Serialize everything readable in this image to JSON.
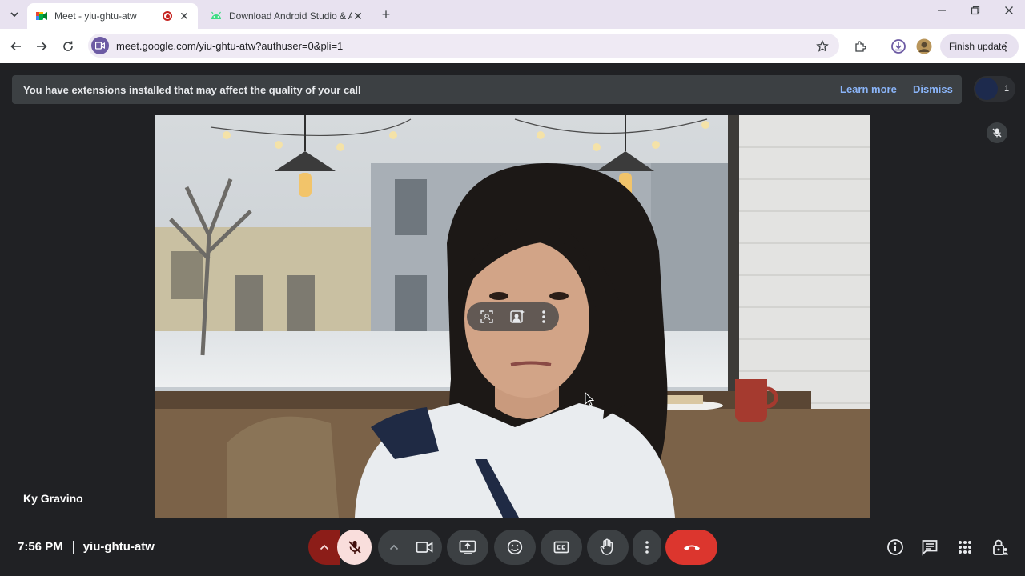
{
  "browser": {
    "tabs": [
      {
        "title": "Meet - yiu-ghtu-atw",
        "favicon": "google-meet-icon",
        "recording": true,
        "active": true
      },
      {
        "title": "Download Android Studio & App",
        "favicon": "android-icon",
        "active": false
      }
    ],
    "url": "meet.google.com/yiu-ghtu-atw?authuser=0&pli=1",
    "finish_update_label": "Finish update"
  },
  "meet": {
    "banner": {
      "message": "You have extensions installed that may affect the quality of your call",
      "learn_more": "Learn more",
      "dismiss": "Dismiss"
    },
    "participant_count": "1",
    "self_name": "Ky Gravino",
    "time": "7:56 PM",
    "meeting_code": "yiu-ghtu-atw",
    "mic_muted": true,
    "controls": [
      "mic-options",
      "microphone",
      "camera-options",
      "camera",
      "present-screen",
      "send-reaction",
      "captions",
      "raise-hand",
      "more-options",
      "leave-call"
    ],
    "side_controls": [
      "meeting-details",
      "chat",
      "activities",
      "host-controls"
    ]
  },
  "colors": {
    "meet_background": "#202124",
    "end_call_red": "#dc362e",
    "muted_mic_pink": "#f9dedc",
    "link_blue": "#8ab4f8"
  }
}
